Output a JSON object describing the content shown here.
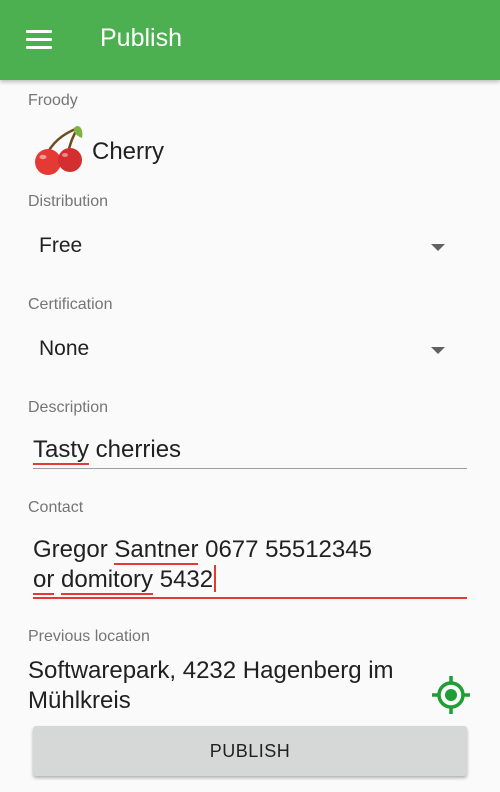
{
  "appbar": {
    "title": "Publish",
    "menu_icon": "hamburger-menu-icon",
    "color": "#4caf50"
  },
  "froody": {
    "label": "Froody",
    "icon": "cherry-icon",
    "name": "Cherry"
  },
  "distribution": {
    "label": "Distribution",
    "value": "Free"
  },
  "certification": {
    "label": "Certification",
    "value": "None"
  },
  "description": {
    "label": "Description",
    "words": [
      "Tasty",
      " cherries"
    ]
  },
  "contact": {
    "label": "Contact",
    "line1": [
      "Gregor",
      " ",
      "Santner",
      " 0677 55512345"
    ],
    "line2": [
      "or",
      " ",
      "domitory",
      " 5432"
    ]
  },
  "previous_location": {
    "label": "Previous location",
    "value": "Softwarepark, 4232 Hagenberg im Mühlkreis",
    "gps_icon": "gps-fixed-icon"
  },
  "publish_button": {
    "label": "PUBLISH"
  },
  "colors": {
    "accent": "#4caf50",
    "error": "#e53935",
    "button_bg": "#d6d7d7"
  }
}
